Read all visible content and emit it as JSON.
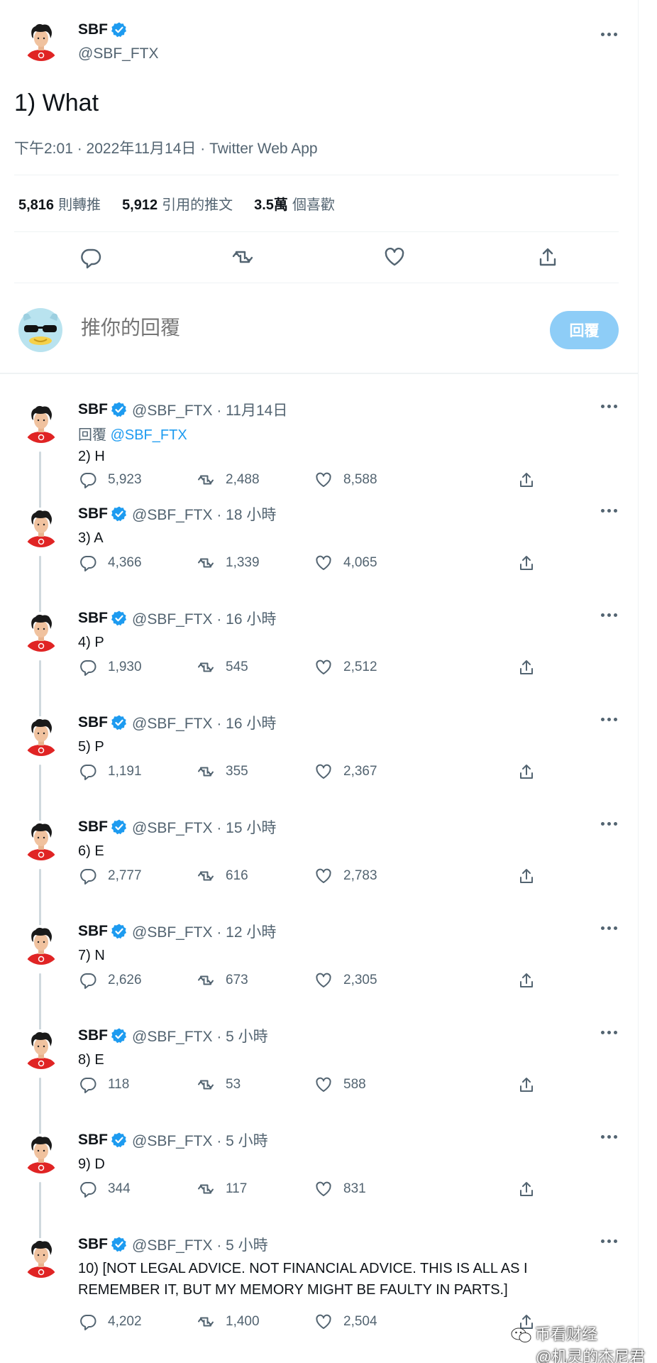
{
  "colors": {
    "accent": "#1d9bf0",
    "muted": "#536471",
    "text": "#0f1419",
    "reply_button": "#8ecdf7"
  },
  "main_tweet": {
    "name": "SBF",
    "handle": "@SBF_FTX",
    "text": "1) What",
    "timestamp": "下午2:01 · 2022年11月14日 · Twitter Web App",
    "stats": [
      {
        "value": "5,816",
        "label": "則轉推"
      },
      {
        "value": "5,912",
        "label": "引用的推文"
      },
      {
        "value": "3.5萬",
        "label": "個喜歡"
      }
    ],
    "actions": [
      "reply-icon",
      "retweet-icon",
      "like-icon",
      "share-icon"
    ]
  },
  "composer": {
    "placeholder": "推你的回覆",
    "button_label": "回覆"
  },
  "replies": [
    {
      "name": "SBF",
      "meta": "@SBF_FTX · 11月14日",
      "replying_prefix": "回覆",
      "replying_mention": "@SBF_FTX",
      "text": "2) H",
      "replies": "5,923",
      "retweets": "2,488",
      "likes": "8,588"
    },
    {
      "name": "SBF",
      "meta": "@SBF_FTX · 18 小時",
      "text": "3) A",
      "replies": "4,366",
      "retweets": "1,339",
      "likes": "4,065"
    },
    {
      "name": "SBF",
      "meta": "@SBF_FTX · 16 小時",
      "text": "4) P",
      "replies": "1,930",
      "retweets": "545",
      "likes": "2,512"
    },
    {
      "name": "SBF",
      "meta": "@SBF_FTX · 16 小時",
      "text": "5) P",
      "replies": "1,191",
      "retweets": "355",
      "likes": "2,367"
    },
    {
      "name": "SBF",
      "meta": "@SBF_FTX · 15 小時",
      "text": "6) E",
      "replies": "2,777",
      "retweets": "616",
      "likes": "2,783"
    },
    {
      "name": "SBF",
      "meta": "@SBF_FTX · 12 小時",
      "text": "7) N",
      "replies": "2,626",
      "retweets": "673",
      "likes": "2,305"
    },
    {
      "name": "SBF",
      "meta": "@SBF_FTX · 5 小時",
      "text": "8) E",
      "replies": "118",
      "retweets": "53",
      "likes": "588"
    },
    {
      "name": "SBF",
      "meta": "@SBF_FTX · 5 小時",
      "text": "9) D",
      "replies": "344",
      "retweets": "117",
      "likes": "831"
    },
    {
      "name": "SBF",
      "meta": "@SBF_FTX · 5 小時",
      "text": "10) [NOT LEGAL ADVICE.  NOT FINANCIAL ADVICE.  THIS IS ALL AS I REMEMBER IT, BUT MY MEMORY MIGHT BE FAULTY IN PARTS.]",
      "replies": "4,202",
      "retweets": "1,400",
      "likes": "2,504"
    }
  ],
  "watermark": {
    "line1": "币看财经",
    "line2": "@机灵的杰尼君"
  }
}
